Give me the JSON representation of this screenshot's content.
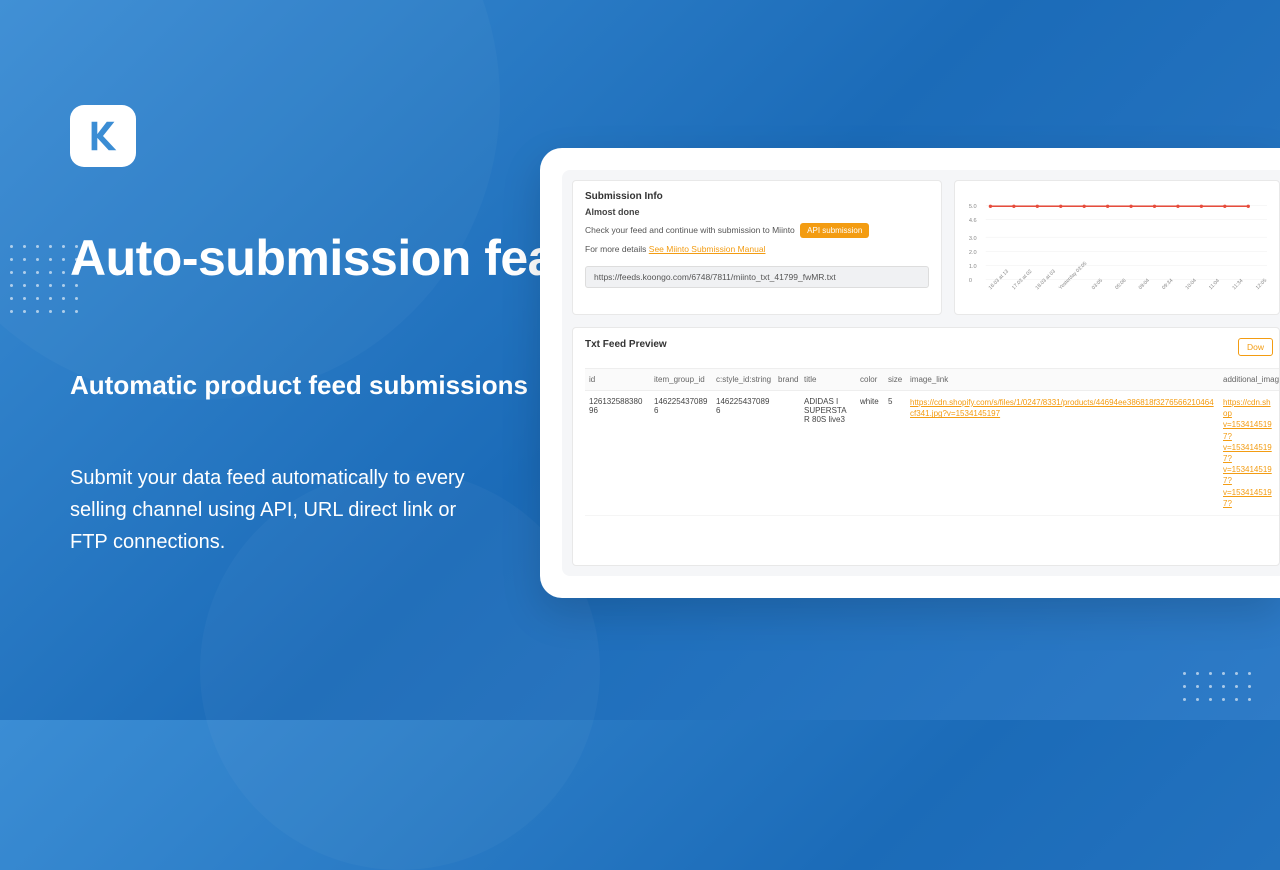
{
  "hero": {
    "headline": "Auto-submission features",
    "subhead": "Automatic product feed submissions",
    "body": "Submit your data feed automatically to every selling channel using API, URL direct link or FTP connections."
  },
  "submission": {
    "title": "Submission Info",
    "status": "Almost done",
    "check_text": "Check your feed and continue with submission to Miinto",
    "api_button": "API submission",
    "details_prefix": "For more details ",
    "manual_link": "See Miinto Submission Manual",
    "url_value": "https://feeds.koongo.com/6748/7811/miinto_txt_41799_fwMR.txt"
  },
  "chart_data": {
    "type": "line",
    "ylim": [
      0,
      5
    ],
    "y_ticks": [
      "5.0",
      "4.6",
      "3.0",
      "2.0",
      "1.0",
      "0"
    ],
    "x_labels": [
      "16.03 at 13",
      "17.03 at 02",
      "18.03 at 03",
      "Yesterday 03:05",
      "03:05",
      "05:06",
      "09:04",
      "09:34",
      "10:04",
      "11:04",
      "11:34",
      "12:05"
    ],
    "series": [
      {
        "name": "",
        "values": [
          5,
          5,
          5,
          5,
          5,
          5,
          5,
          5,
          5,
          5,
          5,
          5
        ]
      }
    ],
    "color": "#E74C3C"
  },
  "preview": {
    "title": "Txt Feed Preview",
    "download_label": "Dow",
    "columns": [
      "id",
      "item_group_id",
      "c:style_id:string",
      "brand",
      "title",
      "color",
      "size",
      "image_link",
      "additional_imag"
    ],
    "row": {
      "id": "12613258838096",
      "item_group_id": "1462254370896",
      "style_id": "1462254370896",
      "brand": "",
      "title": "ADIDAS I SUPERSTAR 80S live3",
      "color": "white",
      "size": "5",
      "image_link": "https://cdn.shopify.com/s/files/1/0247/8331/products/44694ee386818f3276566210464cf341.jpg?v=1534145197",
      "additional_links": [
        "https://cdn.shop",
        "v=1534145197?",
        "v=1534145197?",
        "v=1534145197?",
        "v=1534145197?"
      ]
    }
  }
}
